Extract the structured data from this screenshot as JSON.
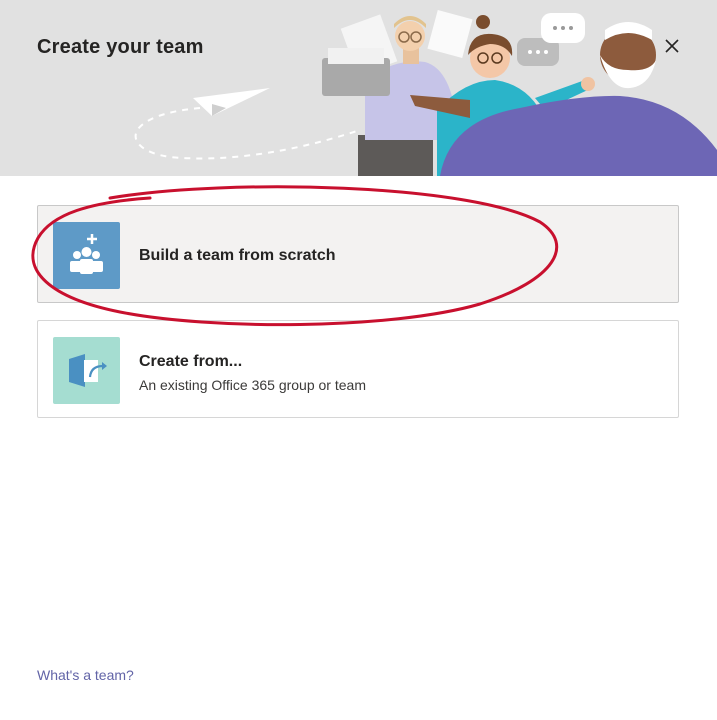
{
  "dialog": {
    "title": "Create your team",
    "close_label": "Close",
    "footer_link": "What's a team?"
  },
  "options": [
    {
      "title": "Build a team from scratch",
      "subtitle": "",
      "icon": "team-add-icon"
    },
    {
      "title": "Create from...",
      "subtitle": "An existing Office 365 group or team",
      "icon": "create-from-icon"
    }
  ],
  "colors": {
    "header_bg": "#e1e1e1",
    "accent": "#6264a7",
    "annotation": "#c8102e",
    "icon_blue": "#5e9ac7",
    "icon_teal": "#a5ddd1"
  }
}
